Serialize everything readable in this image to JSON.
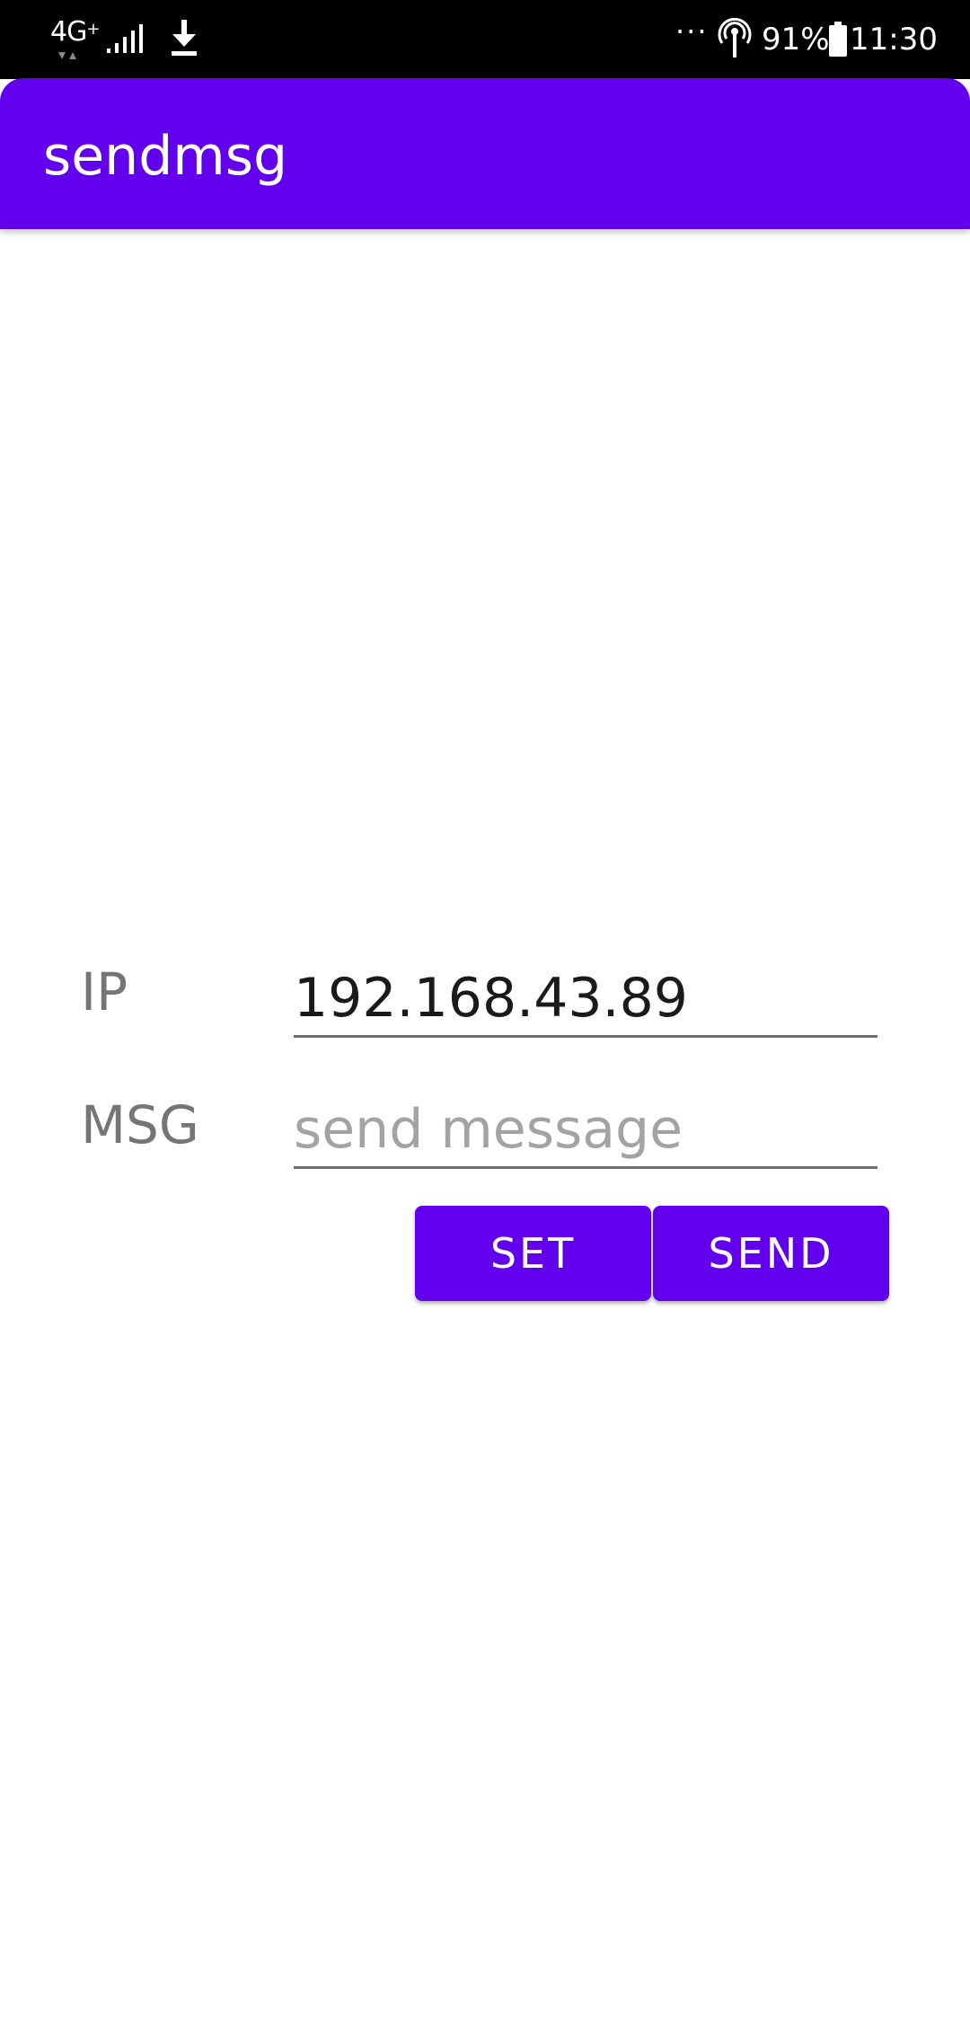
{
  "status_bar": {
    "network_type": "4G",
    "network_sub": "+",
    "battery_percent": "91%",
    "time": "11:30",
    "overflow_dots": "···",
    "icons": [
      "signal-icon",
      "download-icon",
      "hotspot-icon",
      "battery-icon"
    ]
  },
  "app_bar": {
    "title": "sendmsg",
    "color": "#6200ee"
  },
  "form": {
    "ip_label": "IP",
    "ip_value": "192.168.43.89",
    "msg_label": "MSG",
    "msg_value": "",
    "msg_placeholder": "send message"
  },
  "buttons": {
    "set_label": "SET",
    "send_label": "SEND"
  }
}
